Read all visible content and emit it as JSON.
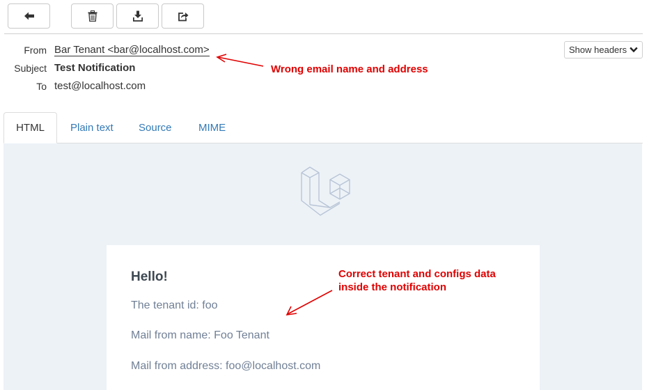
{
  "toolbar": {
    "buttons": [
      {
        "name": "back",
        "icon": "arrow-left-icon"
      },
      {
        "name": "delete",
        "icon": "trash-icon"
      },
      {
        "name": "download",
        "icon": "download-icon"
      },
      {
        "name": "forward",
        "icon": "share-icon"
      }
    ]
  },
  "headers": {
    "from_label": "From",
    "from_value": "Bar Tenant <bar@localhost.com>",
    "subject_label": "Subject",
    "subject_value": "Test Notification",
    "to_label": "To",
    "to_value": "test@localhost.com",
    "show_headers_label": "Show headers"
  },
  "annotations": {
    "wrong_from": "Wrong email name and address",
    "correct_data_line1": "Correct tenant and configs data",
    "correct_data_line2": "inside the notification",
    "color": "#e00000"
  },
  "tabs": [
    {
      "label": "HTML",
      "active": true
    },
    {
      "label": "Plain text",
      "active": false
    },
    {
      "label": "Source",
      "active": false
    },
    {
      "label": "MIME",
      "active": false
    }
  ],
  "email": {
    "logo": "laravel-logo-icon",
    "greeting": "Hello!",
    "lines": [
      "The tenant id: foo",
      "Mail from name: Foo Tenant",
      "Mail from address: foo@localhost.com"
    ],
    "background": "#edf2f7",
    "text_color": "#718096"
  }
}
